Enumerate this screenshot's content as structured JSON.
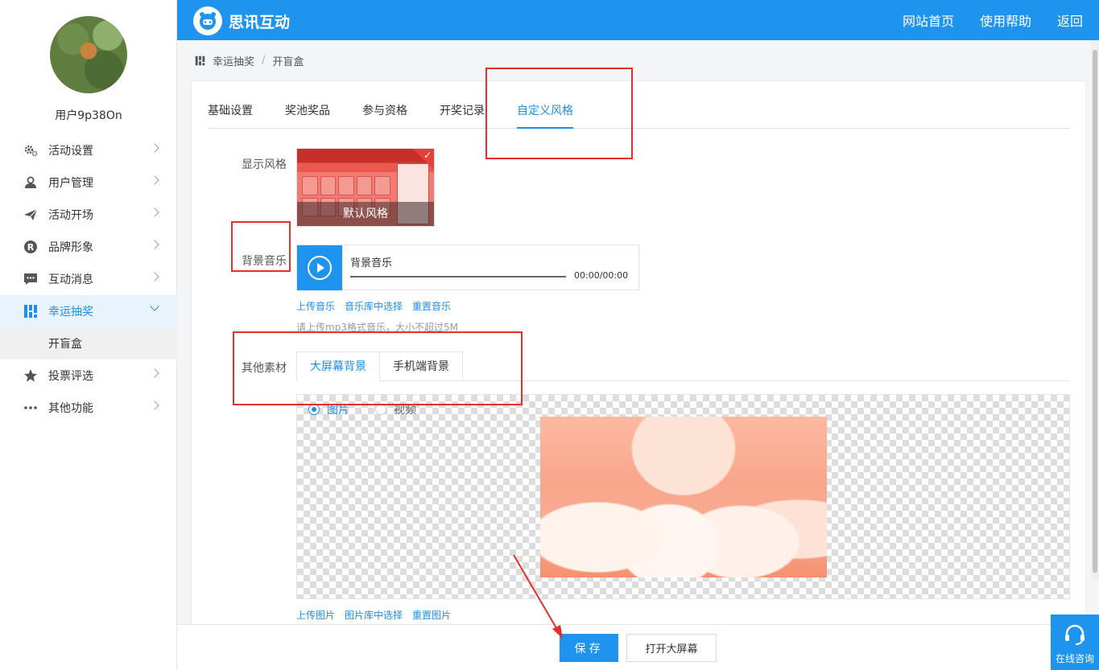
{
  "header": {
    "brand": "思讯互动",
    "nav": [
      "网站首页",
      "使用帮助",
      "返回"
    ]
  },
  "user": {
    "name": "用户9p38On"
  },
  "sidebar": {
    "items": [
      {
        "label": "活动设置",
        "icon": "gear-icon"
      },
      {
        "label": "用户管理",
        "icon": "user-icon"
      },
      {
        "label": "活动开场",
        "icon": "paper-plane-icon"
      },
      {
        "label": "品牌形象",
        "icon": "registered-icon"
      },
      {
        "label": "互动消息",
        "icon": "chat-icon"
      },
      {
        "label": "幸运抽奖",
        "icon": "lottery-icon"
      },
      {
        "label": "投票评选",
        "icon": "star-icon"
      },
      {
        "label": "其他功能",
        "icon": "more-icon"
      }
    ],
    "sub_item": "开盲盒"
  },
  "breadcrumb": {
    "parent": "幸运抽奖",
    "sep": "/",
    "current": "开盲盒"
  },
  "tabs": [
    "基础设置",
    "奖池奖品",
    "参与资格",
    "开奖记录",
    "自定义风格"
  ],
  "form": {
    "style_label": "显示风格",
    "style_name": "默认风格",
    "music_label": "背景音乐",
    "music_title": "背景音乐",
    "music_time": "00:00/00:00",
    "music_links": [
      "上传音乐",
      "音乐库中选择",
      "重置音乐"
    ],
    "music_hint": "请上传mp3格式音乐，大小不超过5M",
    "material_label": "其他素材",
    "sub_tabs": [
      "大屏幕背景",
      "手机端背景"
    ],
    "media_options": [
      "图片",
      "视频"
    ],
    "image_links": [
      "上传图片",
      "图片库中选择",
      "重置图片"
    ]
  },
  "actions": {
    "save": "保存",
    "open_screen": "打开大屏幕"
  },
  "consult": {
    "label": "在线咨询"
  },
  "colors": {
    "primary": "#1e94ee",
    "annotation": "#e62e2e"
  }
}
